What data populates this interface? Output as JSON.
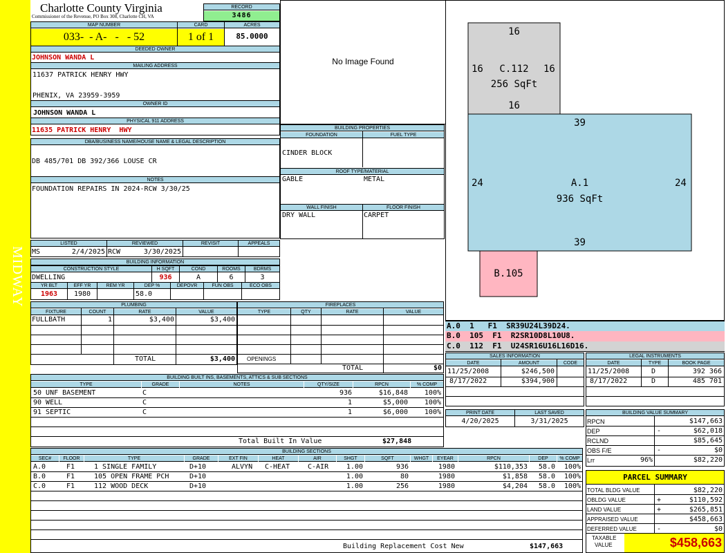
{
  "side_label": "MIDWAY",
  "county": {
    "name": "Charlotte County Virginia",
    "sub": "Commissioner of the Revenue, PO Box 308, Charlotte CH, VA"
  },
  "record": {
    "label": "RECORD",
    "value": "3486"
  },
  "map": {
    "label": "MAP NUMBER",
    "value": "033-  - A-   -   - 52",
    "card_label": "CARD",
    "card": "1 of 1",
    "acres_label": "ACRES",
    "acres": "85.0000"
  },
  "deeded": {
    "label": "DEEDED OWNER",
    "value": "JOHNSON WANDA L"
  },
  "mailing": {
    "label": "MAILING ADDRESS",
    "line1": "11637 PATRICK HENRY HWY",
    "line2": "PHENIX, VA 23959-3959"
  },
  "owner_id": {
    "label": "OWNER ID",
    "value": "JOHNSON WANDA L"
  },
  "phys911": {
    "label": "PHYSICAL 911 ADDRESS",
    "value": "11635 PATRICK HENRY  HWY"
  },
  "dba": {
    "label": "DBA/BUSINESS NAME/HOUSE NAME & LEGAL DESCRIPTION",
    "value": "DB 485/701 DB 392/366 LOUSE CR"
  },
  "notes": {
    "label": "NOTES",
    "value": "FOUNDATION REPAIRS IN 2024-RCW 3/30/25"
  },
  "image": {
    "text": "No Image Found"
  },
  "bprops": {
    "title": "BUILDING PROPERTIES",
    "foundation_label": "FOUNDATION",
    "fuel_label": "FUEL TYPE",
    "foundation": "CINDER BLOCK",
    "roof_label": "ROOF TYPE/MATERIAL",
    "roof": "GABLE",
    "roof_material": "METAL",
    "wall_label": "WALL FINISH",
    "floor_label": "FLOOR FINISH",
    "wall": "DRY WALL",
    "floor": "CARPET"
  },
  "listed": {
    "h": [
      "LISTED",
      "REVIEWED",
      "REVISIT",
      "APPEALS"
    ],
    "ms": "MS",
    "date1": "2/4/2025",
    "rcw": "RCW",
    "date2": "3/30/2025"
  },
  "binfo": {
    "title": "BUILDING INFORMATION",
    "h": [
      "CONSTRUCTION STYLE",
      "H SQFT",
      "COND",
      "ROOMS",
      "BDRMS"
    ],
    "style": "DWELLING",
    "hsqft": "936",
    "cond": "A",
    "rooms": "6",
    "bdrms": "3",
    "h2": [
      "YR BLT",
      "EFF YR",
      "REM YR",
      "DEP %",
      "DEPOVR",
      "FUN OBS",
      "ECO OBS"
    ],
    "yrblt": "1963",
    "effyr": "1980",
    "dep": "58.0"
  },
  "plumbing": {
    "title": "PLUMBING",
    "h": [
      "FIXTURE",
      "COUNT",
      "RATE",
      "VALUE"
    ],
    "rows": [
      [
        "FULLBATH",
        "1",
        "$3,400",
        "$3,400"
      ]
    ],
    "total_label": "TOTAL",
    "total": "$3,400"
  },
  "fireplaces": {
    "title": "FIREPLACES",
    "h": [
      "TYPE",
      "QTY",
      "RATE",
      "VALUE"
    ],
    "openings": "OPENINGS",
    "total_label": "TOTAL",
    "total": "$0"
  },
  "builtins": {
    "title": "BUILDING BUILT INS, BASEMENTS, ATTICS & SUB SECTIONS",
    "h": [
      "TYPE",
      "GRADE",
      "NOTES",
      "QTY/SIZE",
      "RPCN",
      "% COMP"
    ],
    "rows": [
      [
        "50 UNF BASEMENT",
        "C",
        "",
        "936",
        "$16,848",
        "100%"
      ],
      [
        "90 WELL",
        "C",
        "",
        "1",
        "$5,000",
        "100%"
      ],
      [
        "91 SEPTIC",
        "C",
        "",
        "1",
        "$6,000",
        "100%"
      ]
    ],
    "total_label": "Total Built In Value",
    "total": "$27,848"
  },
  "sections": {
    "title": "BUILDING SECTIONS",
    "h": [
      "SEC#",
      "FLOOR",
      "TYPE",
      "GRADE",
      "EXT FIN",
      "HEAT",
      "AIR",
      "SHGT",
      "SQFT",
      "WHGT",
      "EYEAR",
      "RPCN",
      "DEP",
      "% COMP"
    ],
    "rows": [
      [
        "A.0",
        "F1",
        "1 SINGLE FAMILY",
        "D+10",
        "ALVYN",
        "C-HEAT",
        "C-AIR",
        "1.00",
        "936",
        "",
        "1980",
        "$110,353",
        "58.0",
        "100%"
      ],
      [
        "B.0",
        "F1",
        "105 OPEN FRAME PCH",
        "D+10",
        "",
        "",
        "",
        "1.00",
        "80",
        "",
        "1980",
        "$1,858",
        "58.0",
        "100%"
      ],
      [
        "C.0",
        "F1",
        "112 WOOD DECK",
        "D+10",
        "",
        "",
        "",
        "1.00",
        "256",
        "",
        "1980",
        "$4,204",
        "58.0",
        "100%"
      ]
    ],
    "rcn_label": "Building Replacement Cost New",
    "rcn": "$147,663"
  },
  "sketch": {
    "c_label": "C.112",
    "c_area": "256 SqFt",
    "c_top": "16",
    "c_left": "16",
    "c_right": "16",
    "c_bottom": "16",
    "a_label": "A.1",
    "a_area": "936 SqFt",
    "a_top": "39",
    "a_left": "24",
    "a_right": "24",
    "a_bottom": "39",
    "b_label": "B.105"
  },
  "vectors": [
    "A.0  1   F1  SR39U24L39D24.",
    "B.0  105  F1  R2SR10D8L10U8.",
    "C.0  112  F1  U24SR16U16L16D16."
  ],
  "colors": {
    "a": "#add8e6",
    "b": "#ffb6c1",
    "c": "#d3d3d3",
    "yellow": "#ffff00",
    "green": "#90ee90"
  },
  "sales": {
    "title": "SALES INFORMATION",
    "h": [
      "DATE",
      "AMOUNT",
      "CODE"
    ],
    "rows": [
      [
        "11/25/2008",
        "$246,500",
        ""
      ],
      [
        "8/17/2022",
        "$394,900",
        ""
      ]
    ]
  },
  "legal": {
    "title": "LEGAL INSTRUMENTS",
    "h": [
      "DATE",
      "TYPE",
      "BOOK PAGE"
    ],
    "rows": [
      [
        "11/25/2008",
        "D",
        "392 366"
      ],
      [
        "8/17/2022",
        "D",
        "485 701"
      ]
    ]
  },
  "dates": {
    "h": [
      "PRINT DATE",
      "LAST SAVED"
    ],
    "print": "4/20/2025",
    "saved": "3/31/2025"
  },
  "bvs": {
    "title": "BUILDING VALUE SUMMARY",
    "rows": [
      [
        "RPCN",
        "",
        "$147,663"
      ],
      [
        "DEP",
        "-",
        "$62,018"
      ],
      [
        "RCLND",
        "",
        "$85,645"
      ],
      [
        "OBS F/E",
        "-",
        "$0"
      ],
      [
        "Lrr",
        "96%",
        "$82,220"
      ]
    ]
  },
  "parcel": {
    "title": "PARCEL SUMMARY",
    "rows": [
      [
        "TOTAL BLDG VALUE",
        "",
        "$82,220"
      ],
      [
        "OBLDG VALUE",
        "+",
        "$110,592"
      ],
      [
        "LAND VALUE",
        "+",
        "$265,851"
      ],
      [
        "APPRAISED VALUE",
        "",
        "$458,663"
      ],
      [
        "DEFERRED VALUE",
        "-",
        "$0"
      ]
    ],
    "taxable_label1": "TAXABLE",
    "taxable_label2": "VALUE",
    "taxable": "$458,663"
  }
}
